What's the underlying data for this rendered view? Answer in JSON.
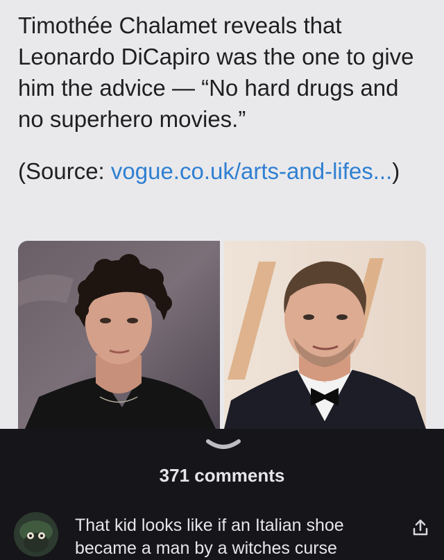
{
  "post": {
    "headline": "Timothée Chalamet reveals that Leonardo DiCapiro was the one to give him the advice — “No hard drugs and no superhero movies.”",
    "source_prefix": "(Source: ",
    "source_link": "vogue.co.uk/arts-and-lifes...",
    "source_suffix": ")",
    "left_photo": "man with curly dark hair in black suit",
    "right_photo": "man with slicked hair in tuxedo and bow tie"
  },
  "comments": {
    "count_label": "371 comments"
  },
  "comment": {
    "text": "That kid looks like if an Italian shoe became a man by a witches curse"
  },
  "icons": {
    "chevron": "chevron-down-icon",
    "share": "share-icon"
  },
  "colors": {
    "post_background": "#e9e9ec",
    "link": "#2f7fd1",
    "comments_background": "#16161a",
    "comments_text": "#e6e6ea"
  }
}
